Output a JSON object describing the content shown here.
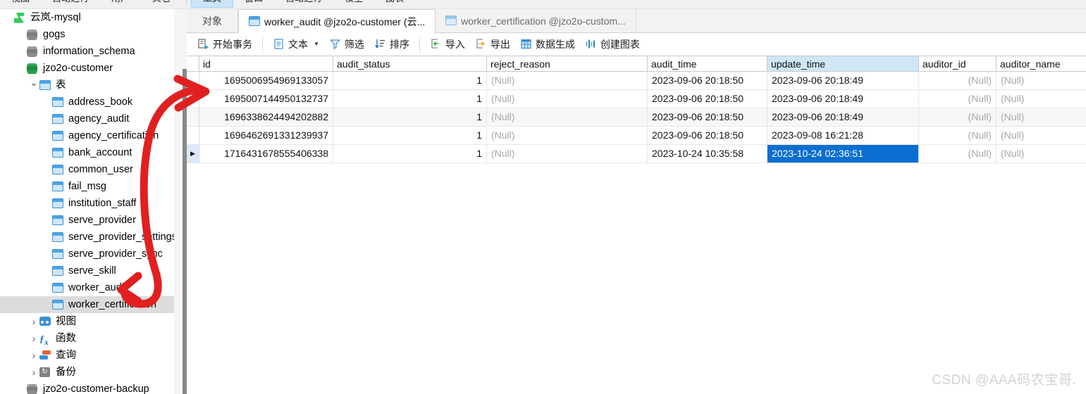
{
  "app": {
    "watermark": "CSDN @AAA码农宝哥."
  },
  "menubar": {
    "items": [
      {
        "label": "视图",
        "active": false
      },
      {
        "label": "自动运行",
        "active": false
      },
      {
        "label": "用户",
        "active": false
      },
      {
        "label": "其它",
        "active": false
      },
      {
        "label": "工具",
        "active": true
      },
      {
        "label": "窗口",
        "active": false
      },
      {
        "label": "自动运行",
        "active": false
      },
      {
        "label": "模型",
        "active": false
      },
      {
        "label": "图表",
        "active": false
      }
    ]
  },
  "sidebar": {
    "items": [
      {
        "label": "云岚-mysql",
        "icon": "connection-icon",
        "indent": 0,
        "twisty": "",
        "selected": false
      },
      {
        "label": "gogs",
        "icon": "database-icon",
        "indent": 1,
        "twisty": "",
        "selected": false
      },
      {
        "label": "information_schema",
        "icon": "database-icon",
        "indent": 1,
        "twisty": "",
        "selected": false
      },
      {
        "label": "jzo2o-customer",
        "icon": "database-open-icon",
        "indent": 1,
        "twisty": "",
        "selected": false
      },
      {
        "label": "表",
        "icon": "table-folder-icon",
        "indent": 2,
        "twisty": "expanded",
        "selected": false
      },
      {
        "label": "address_book",
        "icon": "table-icon",
        "indent": 3,
        "twisty": "",
        "selected": false
      },
      {
        "label": "agency_audit",
        "icon": "table-icon",
        "indent": 3,
        "twisty": "",
        "selected": false
      },
      {
        "label": "agency_certification",
        "icon": "table-icon",
        "indent": 3,
        "twisty": "",
        "selected": false
      },
      {
        "label": "bank_account",
        "icon": "table-icon",
        "indent": 3,
        "twisty": "",
        "selected": false
      },
      {
        "label": "common_user",
        "icon": "table-icon",
        "indent": 3,
        "twisty": "",
        "selected": false
      },
      {
        "label": "fail_msg",
        "icon": "table-icon",
        "indent": 3,
        "twisty": "",
        "selected": false
      },
      {
        "label": "institution_staff",
        "icon": "table-icon",
        "indent": 3,
        "twisty": "",
        "selected": false
      },
      {
        "label": "serve_provider",
        "icon": "table-icon",
        "indent": 3,
        "twisty": "",
        "selected": false
      },
      {
        "label": "serve_provider_settings",
        "icon": "table-icon",
        "indent": 3,
        "twisty": "",
        "selected": false
      },
      {
        "label": "serve_provider_sync",
        "icon": "table-icon",
        "indent": 3,
        "twisty": "",
        "selected": false
      },
      {
        "label": "serve_skill",
        "icon": "table-icon",
        "indent": 3,
        "twisty": "",
        "selected": false
      },
      {
        "label": "worker_audit",
        "icon": "table-icon",
        "indent": 3,
        "twisty": "",
        "selected": false
      },
      {
        "label": "worker_certification",
        "icon": "table-icon",
        "indent": 3,
        "twisty": "",
        "selected": true
      },
      {
        "label": "视图",
        "icon": "view-icon",
        "indent": 2,
        "twisty": "collapsed",
        "selected": false
      },
      {
        "label": "函数",
        "icon": "function-icon",
        "indent": 2,
        "twisty": "collapsed",
        "selected": false
      },
      {
        "label": "查询",
        "icon": "query-icon",
        "indent": 2,
        "twisty": "collapsed",
        "selected": false
      },
      {
        "label": "备份",
        "icon": "backup-icon",
        "indent": 2,
        "twisty": "collapsed",
        "selected": false
      },
      {
        "label": "jzo2o-customer-backup",
        "icon": "database-icon",
        "indent": 1,
        "twisty": "",
        "selected": false
      }
    ]
  },
  "tabs": [
    {
      "label": "对象",
      "kind": "object",
      "active": false
    },
    {
      "label": "worker_audit @jzo2o-customer (云...",
      "kind": "table",
      "active": true
    },
    {
      "label": "worker_certification @jzo2o-custom...",
      "kind": "table",
      "active": false
    }
  ],
  "toolbar": {
    "groups": [
      [
        {
          "label": "开始事务",
          "icon": "transaction-icon",
          "caret": false
        }
      ],
      [
        {
          "label": "文本",
          "icon": "text-icon",
          "caret": true
        },
        {
          "label": "筛选",
          "icon": "filter-icon",
          "caret": false
        },
        {
          "label": "排序",
          "icon": "sort-icon",
          "caret": false
        }
      ],
      [
        {
          "label": "导入",
          "icon": "import-icon",
          "caret": false
        },
        {
          "label": "导出",
          "icon": "export-icon",
          "caret": false
        },
        {
          "label": "数据生成",
          "icon": "data-generate-icon",
          "caret": false
        },
        {
          "label": "创建图表",
          "icon": "create-chart-icon",
          "caret": false
        }
      ]
    ]
  },
  "grid": {
    "columns": [
      {
        "key": "id",
        "label": "id",
        "width": "w-id",
        "highlighted": false
      },
      {
        "key": "audit_status",
        "label": "audit_status",
        "width": "w-status",
        "highlighted": false
      },
      {
        "key": "reject_reason",
        "label": "reject_reason",
        "width": "w-reject",
        "highlighted": false
      },
      {
        "key": "audit_time",
        "label": "audit_time",
        "width": "w-audit",
        "highlighted": false
      },
      {
        "key": "update_time",
        "label": "update_time",
        "width": "w-update",
        "highlighted": true
      },
      {
        "key": "auditor_id",
        "label": "auditor_id",
        "width": "w-aid",
        "highlighted": false
      },
      {
        "key": "auditor_name",
        "label": "auditor_name",
        "width": "w-aname",
        "highlighted": false
      }
    ],
    "null_text": "(Null)",
    "rows": [
      {
        "marker": "",
        "current": false,
        "alt": false,
        "selected_col": null,
        "id": "1695006954969133057",
        "audit_status": "1",
        "reject_reason": "(Null)",
        "audit_time": "2023-09-06 20:18:50",
        "update_time": "2023-09-06 20:18:49",
        "auditor_id": "(Null)",
        "auditor_name": "(Null)"
      },
      {
        "marker": "",
        "current": false,
        "alt": false,
        "selected_col": null,
        "id": "1695007144950132737",
        "audit_status": "1",
        "reject_reason": "(Null)",
        "audit_time": "2023-09-06 20:18:50",
        "update_time": "2023-09-06 20:18:49",
        "auditor_id": "(Null)",
        "auditor_name": "(Null)"
      },
      {
        "marker": "",
        "current": false,
        "alt": true,
        "selected_col": null,
        "id": "1696338624494202882",
        "audit_status": "1",
        "reject_reason": "(Null)",
        "audit_time": "2023-09-06 20:18:50",
        "update_time": "2023-09-06 20:18:49",
        "auditor_id": "(Null)",
        "auditor_name": "(Null)"
      },
      {
        "marker": "",
        "current": false,
        "alt": false,
        "selected_col": null,
        "id": "1696462691331239937",
        "audit_status": "1",
        "reject_reason": "(Null)",
        "audit_time": "2023-09-06 20:18:50",
        "update_time": "2023-09-08 16:21:28",
        "auditor_id": "(Null)",
        "auditor_name": "(Null)"
      },
      {
        "marker": "▶",
        "current": true,
        "alt": false,
        "selected_col": "update_time",
        "id": "1716431678555406338",
        "audit_status": "1",
        "reject_reason": "(Null)",
        "audit_time": "2023-10-24 10:35:58",
        "update_time": "2023-10-24 02:36:51",
        "auditor_id": "(Null)",
        "auditor_name": "(Null)"
      }
    ]
  },
  "annotations": {
    "color": "#e02020",
    "shapes": [
      "curved-double-arrow-pointing-from-worker-certification-to-second-row"
    ]
  }
}
